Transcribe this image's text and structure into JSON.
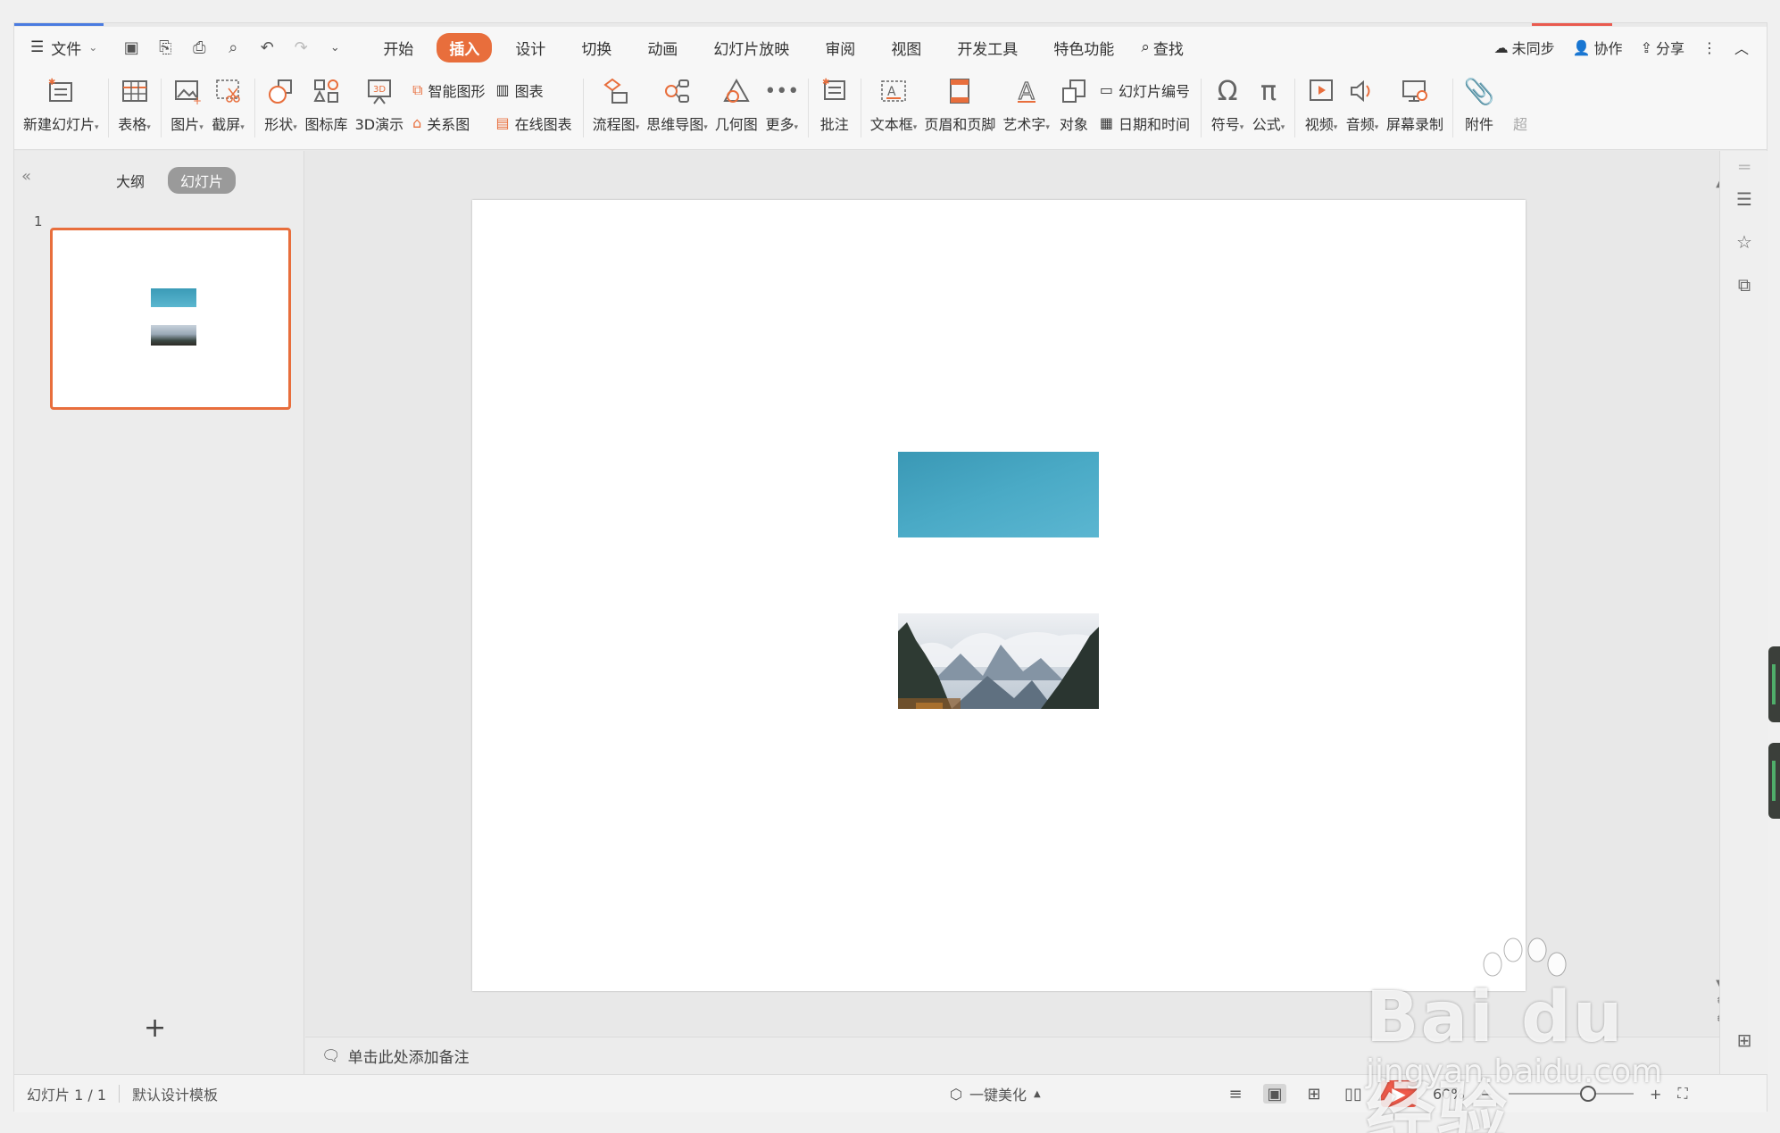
{
  "menubar": {
    "file_label": "文件",
    "tabs": [
      "开始",
      "插入",
      "设计",
      "切换",
      "动画",
      "幻灯片放映",
      "审阅",
      "视图",
      "开发工具",
      "特色功能"
    ],
    "active_tab": "插入",
    "search_label": "查找",
    "sync_label": "未同步",
    "collab_label": "协作",
    "share_label": "分享"
  },
  "ribbon": {
    "new_slide": "新建幻灯片",
    "table": "表格",
    "picture": "图片",
    "screenshot": "截屏",
    "shape": "形状",
    "icon_lib": "图标库",
    "demo_3d": "3D演示",
    "smart_art": "智能图形",
    "relation": "关系图",
    "chart": "图表",
    "online_chart": "在线图表",
    "flowchart": "流程图",
    "mindmap": "思维导图",
    "geometry": "几何图",
    "more": "更多",
    "comment": "批注",
    "textbox": "文本框",
    "header_footer": "页眉和页脚",
    "wordart": "艺术字",
    "object": "对象",
    "slide_number": "幻灯片编号",
    "datetime": "日期和时间",
    "symbol": "符号",
    "formula": "公式",
    "video": "视频",
    "audio": "音频",
    "screen_record": "屏幕录制",
    "attachment": "附件",
    "hyperlink_partial": "超"
  },
  "left_panel": {
    "tab_outline": "大纲",
    "tab_slides": "幻灯片",
    "slide_number": "1"
  },
  "notes_placeholder": "单击此处添加备注",
  "statusbar": {
    "slide_counter": "幻灯片 1 / 1",
    "template": "默认设计模板",
    "beautify": "一键美化",
    "zoom": "60%"
  },
  "watermark": {
    "brand": "Bai du 经验",
    "url": "jingyan.baidu.com"
  },
  "colors": {
    "accent": "#e86e3c",
    "play": "#ef5a4a",
    "tab_blue": "#4a7be0"
  }
}
